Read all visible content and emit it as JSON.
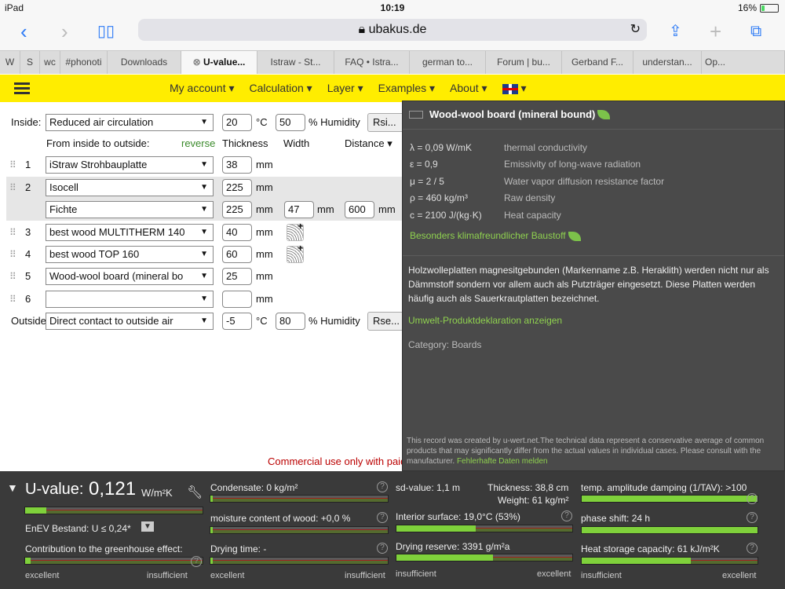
{
  "status": {
    "device": "iPad",
    "time": "10:19",
    "battery": "16%"
  },
  "browser": {
    "url": "ubakus.de"
  },
  "tabs": [
    "W",
    "S",
    "wc",
    "#phonoti",
    "Downloads",
    "U-value...",
    "Istraw - St...",
    "FAQ • Istra...",
    "german to...",
    "Forum | bu...",
    "Gerband F...",
    "understan...",
    "Op..."
  ],
  "nav": {
    "items": [
      "My account ▾",
      "Calculation ▾",
      "Layer ▾",
      "Examples ▾",
      "About ▾"
    ],
    "lang": "▾"
  },
  "inside": {
    "label": "Inside:",
    "select": "Reduced air circulation",
    "temp": "20",
    "temp_unit": "°C",
    "hum": "50",
    "hum_unit": "% Humidity",
    "rsi": "Rsi..."
  },
  "headers": {
    "from": "From inside to outside:",
    "reverse": "reverse",
    "thickness": "Thickness",
    "width": "Width",
    "distance": "Distance ▾"
  },
  "layers": [
    {
      "n": "1",
      "material": "iStraw Strohbauplatte",
      "thickness": "38",
      "unit": "mm"
    },
    {
      "n": "2",
      "material": "Isocell",
      "thickness": "225",
      "unit": "mm"
    },
    {
      "n": "",
      "material": "Fichte",
      "thickness": "225",
      "unit": "mm",
      "width": "47",
      "width_unit": "mm",
      "distance": "600",
      "distance_unit": "mm"
    },
    {
      "n": "3",
      "material": "best wood MULTITHERM 140",
      "thickness": "40",
      "unit": "mm"
    },
    {
      "n": "4",
      "material": "best wood TOP 160",
      "thickness": "60",
      "unit": "mm"
    },
    {
      "n": "5",
      "material": "Wood-wool board (mineral bo",
      "thickness": "25",
      "unit": "mm"
    },
    {
      "n": "6",
      "material": "",
      "thickness": "",
      "unit": "mm"
    }
  ],
  "outside": {
    "label": "Outside",
    "select": "Direct contact to outside air",
    "temp": "-5",
    "temp_unit": "°C",
    "hum": "80",
    "hum_unit": "% Humidity",
    "rse": "Rse..."
  },
  "commercial": "Commercial use only with paid",
  "popup": {
    "title": "Wood-wool board (mineral bound)",
    "props": [
      {
        "v": "λ = 0,09 W/mK",
        "d": "thermal conductivity"
      },
      {
        "v": "ε = 0,9",
        "d": "Emissivity of long-wave radiation"
      },
      {
        "v": "μ = 2 / 5",
        "d": "Water vapor diffusion resistance factor"
      },
      {
        "v": "ρ = 460 kg/m³",
        "d": "Raw density"
      },
      {
        "v": "c = 2100 J/(kg·K)",
        "d": "Heat capacity"
      }
    ],
    "eco": "Besonders klimafreundlicher Baustoff",
    "description": "Holzwolleplatten magnesitgebunden (Markenname z.B. Heraklith) werden nicht nur als Dämmstoff sondern vor allem auch als Putzträger eingesetzt. Diese Platten werden häufig auch als Sauerkrautplatten bezeichnet.",
    "umwelt": "Umwelt-Produktdeklaration anzeigen",
    "category": "Category: Boards",
    "footer": "This record was created by u-wert.net.The technical data represent a conservative average of common products that may significantly differ from the actual values in individual cases. Please consult with the manufacturer.",
    "footer_link": "Fehlerhafte Daten melden"
  },
  "results": {
    "uvalue_label": "U-value:",
    "uvalue": "0,121",
    "uvalue_unit": "W/m²K",
    "enev": "EnEV Bestand: U ≤ 0,24*",
    "greenhouse": "Contribution to the greenhouse effect:",
    "condensate": "Condensate: 0 kg/m²",
    "moisture": "moisture content of wood: +0,0 %",
    "drying": "Drying time: -",
    "sd": "sd-value: 1,1 m",
    "thickness": "Thickness: 38,8 cm",
    "weight": "Weight: 61 kg/m²",
    "interior": "Interior surface: 19,0°C (53%)",
    "reserve": "Drying reserve: 3391 g/m²a",
    "damping": "temp. amplitude damping (1/TAV): >100",
    "phase": "phase shift: 24 h",
    "storage": "Heat storage capacity: 61 kJ/m²K",
    "scale": {
      "excellent": "excellent",
      "insufficient": "insufficient"
    },
    "fills": {
      "uvalue": 0.12,
      "greenhouse": 0.03,
      "condensate": 0.0,
      "moisture": 0.0,
      "drying": 0.0,
      "sd": 0.0,
      "interior": 0.45,
      "reserve": 0.55,
      "damping": 1.0,
      "phase": 1.0,
      "storage": 0.62
    }
  }
}
